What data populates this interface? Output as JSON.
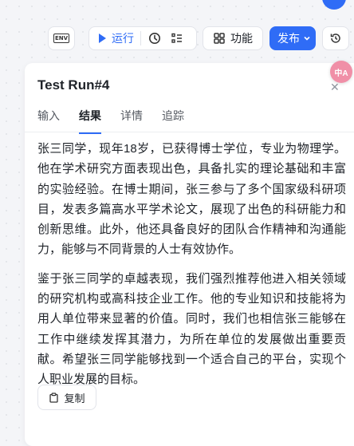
{
  "toolbar": {
    "env_label": "ENV",
    "run_label": "运行",
    "function_label": "功能",
    "publish_label": "发布"
  },
  "panel": {
    "title": "Test Run#4",
    "tabs": [
      {
        "label": "输入",
        "active": false
      },
      {
        "label": "结果",
        "active": true
      },
      {
        "label": "详情",
        "active": false
      },
      {
        "label": "追踪",
        "active": false
      }
    ],
    "paragraphs": [
      "张三同学，现年18岁，已获得博士学位，专业为物理学。他在学术研究方面表现出色，具备扎实的理论基础和丰富的实验经验。在博士期间，张三参与了多个国家级科研项目，发表多篇高水平学术论文，展现了出色的科研能力和创新思维。此外，他还具备良好的团队合作精神和沟通能力，能够与不同背景的人士有效协作。",
      "鉴于张三同学的卓越表现，我们强烈推荐他进入相关领域的研究机构或高科技企业工作。他的专业知识和技能将为用人单位带来显著的价值。同时，我们也相信张三能够在工作中继续发挥其潜力，为所在单位的发展做出重要贡献。希望张三同学能够找到一个适合自己的平台，实现个人职业发展的目标。"
    ],
    "copy_label": "复制"
  },
  "translate_badge": "中A",
  "colors": {
    "accent": "#2f6cf6",
    "badge": "#f08fa7"
  }
}
